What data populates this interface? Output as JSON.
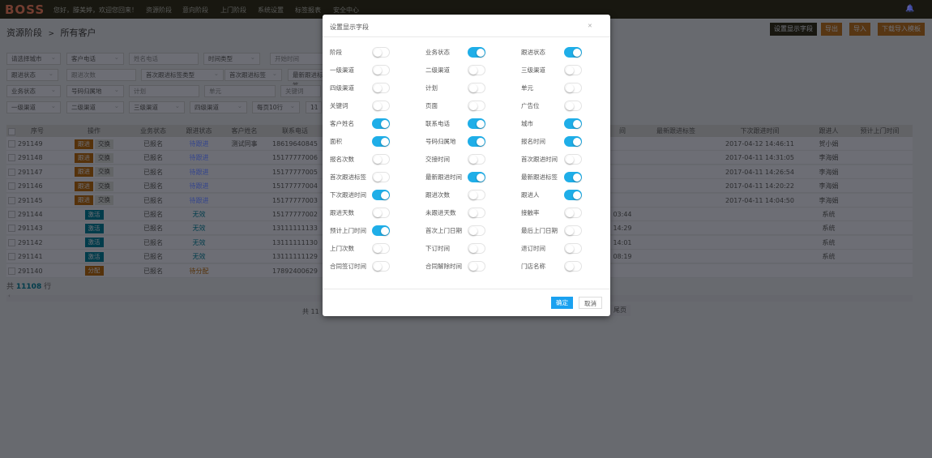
{
  "nav": {
    "logo": "BOSS",
    "greeting": "您好，滕美婷，欢迎您回来！",
    "items": [
      "资源阶段",
      "意向阶段",
      "上门阶段",
      "系统设置",
      "标签报表",
      "安全中心"
    ]
  },
  "breadcrumb": {
    "parent": "资源阶段",
    "sep": ">",
    "current": "所有客户"
  },
  "toolbar": {
    "set_fields": "设置显示字段",
    "export": "导出",
    "import": "导入",
    "download_template": "下载导入模板"
  },
  "filters": [
    [
      {
        "t": "请选择城市",
        "s": 1
      },
      {
        "t": "客户电话",
        "s": 1
      },
      {
        "t": "姓名电话",
        "s": 0
      },
      {
        "t": "时间类型",
        "s": 1
      },
      {
        "t": "开始时间",
        "s": 0
      }
    ],
    [
      {
        "t": "跟进状态",
        "s": 1
      },
      {
        "t": "跟进次数",
        "s": 0
      },
      {
        "t": "首次跟进标签类型",
        "s": 1
      },
      {
        "t": "首次跟进标签",
        "s": 1
      },
      {
        "t": "最新跟进标签",
        "s": 1
      }
    ],
    [
      {
        "t": "业务状态",
        "s": 1
      },
      {
        "t": "号码归属地",
        "s": 1
      },
      {
        "t": "计划",
        "s": 0
      },
      {
        "t": "单元",
        "s": 0
      },
      {
        "t": "关键词",
        "s": 0
      }
    ],
    [
      {
        "t": "一级渠道",
        "s": 1
      },
      {
        "t": "二级渠道",
        "s": 1
      },
      {
        "t": "三级渠道",
        "s": 1
      },
      {
        "t": "四级渠道",
        "s": 1
      },
      {
        "t": "每页10行",
        "s": 1
      },
      {
        "t": "11",
        "s": 1
      }
    ]
  ],
  "table": {
    "headers": [
      "序号",
      "操作",
      "业务状态",
      "跟进状态",
      "客户姓名",
      "联系电话",
      "间",
      "最新跟进标签",
      "下次跟进时间",
      "跟进人",
      "预计上门时间"
    ],
    "rows": [
      {
        "id": "291149",
        "actions": [
          "跟进",
          "交换"
        ],
        "biz": "已报名",
        "follow": "待跟进",
        "name": "测试同事",
        "phone": "18619640845",
        "t": "",
        "tag": "",
        "next": "2017-04-12 14:46:11",
        "person": "贺小娟"
      },
      {
        "id": "291148",
        "actions": [
          "跟进",
          "交换"
        ],
        "biz": "已报名",
        "follow": "待跟进",
        "name": "",
        "phone": "15177777006",
        "t": "",
        "tag": "",
        "next": "2017-04-11 14:31:05",
        "person": "李海娟"
      },
      {
        "id": "291147",
        "actions": [
          "跟进",
          "交换"
        ],
        "biz": "已报名",
        "follow": "待跟进",
        "name": "",
        "phone": "15177777005",
        "t": "",
        "tag": "",
        "next": "2017-04-11 14:26:54",
        "person": "李海娟"
      },
      {
        "id": "291146",
        "actions": [
          "跟进",
          "交换"
        ],
        "biz": "已报名",
        "follow": "待跟进",
        "name": "",
        "phone": "15177777004",
        "t": "",
        "tag": "",
        "next": "2017-04-11 14:20:22",
        "person": "李海娟"
      },
      {
        "id": "291145",
        "actions": [
          "跟进",
          "交换"
        ],
        "biz": "已报名",
        "follow": "待跟进",
        "name": "",
        "phone": "15177777003",
        "t": "",
        "tag": "",
        "next": "2017-04-11 14:04:50",
        "person": "李海娟"
      },
      {
        "id": "291144",
        "actions": [
          "激活"
        ],
        "biz": "已报名",
        "follow": "无效",
        "name": "",
        "phone": "15177777002",
        "t": "03:44",
        "tag": "",
        "next": "",
        "person": "系统"
      },
      {
        "id": "291143",
        "actions": [
          "激活"
        ],
        "biz": "已报名",
        "follow": "无效",
        "name": "",
        "phone": "13111111133",
        "t": "14:29",
        "tag": "",
        "next": "",
        "person": "系统"
      },
      {
        "id": "291142",
        "actions": [
          "激活"
        ],
        "biz": "已报名",
        "follow": "无效",
        "name": "",
        "phone": "13111111130",
        "t": "14:01",
        "tag": "",
        "next": "",
        "person": "系统"
      },
      {
        "id": "291141",
        "actions": [
          "激活"
        ],
        "biz": "已报名",
        "follow": "无效",
        "name": "",
        "phone": "13111111129",
        "t": "08:19",
        "tag": "",
        "next": "",
        "person": "系统"
      },
      {
        "id": "291140",
        "actions": [
          "分配"
        ],
        "biz": "已报名",
        "follow": "待分配",
        "name": "",
        "phone": "17892400629",
        "t": "",
        "tag": "",
        "next": "",
        "person": ""
      }
    ],
    "total_prefix": "共",
    "total": "11108",
    "total_suffix": "行"
  },
  "pagination": {
    "total_text": "共 11",
    "last": "尾页"
  },
  "colors": {
    "accent": "#1faee8",
    "follow_pending": "#e0a020",
    "invalid": "#d9534f",
    "assign": "#2a8fd6"
  },
  "modal": {
    "title": "设置显示字段",
    "close_icon": "close-icon",
    "ok": "确定",
    "cancel": "取消",
    "fields": [
      {
        "label": "阶段",
        "on": false
      },
      {
        "label": "业务状态",
        "on": true
      },
      {
        "label": "跟进状态",
        "on": true
      },
      {
        "label": "一级渠道",
        "on": false
      },
      {
        "label": "二级渠道",
        "on": false
      },
      {
        "label": "三级渠道",
        "on": false
      },
      {
        "label": "四级渠道",
        "on": false
      },
      {
        "label": "计划",
        "on": false
      },
      {
        "label": "单元",
        "on": false
      },
      {
        "label": "关键词",
        "on": false
      },
      {
        "label": "页面",
        "on": false
      },
      {
        "label": "广告位",
        "on": false
      },
      {
        "label": "客户姓名",
        "on": true
      },
      {
        "label": "联系电话",
        "on": true
      },
      {
        "label": "城市",
        "on": true
      },
      {
        "label": "面积",
        "on": true
      },
      {
        "label": "号码归属地",
        "on": true
      },
      {
        "label": "报名时间",
        "on": true
      },
      {
        "label": "报名次数",
        "on": false
      },
      {
        "label": "交接时间",
        "on": false
      },
      {
        "label": "首次跟进时间",
        "on": false
      },
      {
        "label": "首次跟进标签",
        "on": false
      },
      {
        "label": "最新跟进时间",
        "on": true
      },
      {
        "label": "最新跟进标签",
        "on": true
      },
      {
        "label": "下次跟进时间",
        "on": true
      },
      {
        "label": "跟进次数",
        "on": false
      },
      {
        "label": "跟进人",
        "on": true
      },
      {
        "label": "跟进天数",
        "on": false
      },
      {
        "label": "未跟进天数",
        "on": false
      },
      {
        "label": "接触率",
        "on": false
      },
      {
        "label": "预计上门时间",
        "on": true
      },
      {
        "label": "首次上门日期",
        "on": false
      },
      {
        "label": "最后上门日期",
        "on": false
      },
      {
        "label": "上门次数",
        "on": false
      },
      {
        "label": "下订时间",
        "on": false
      },
      {
        "label": "退订时间",
        "on": false
      },
      {
        "label": "合同签订时间",
        "on": false
      },
      {
        "label": "合同解除时间",
        "on": false
      },
      {
        "label": "门店名称",
        "on": false
      }
    ]
  }
}
